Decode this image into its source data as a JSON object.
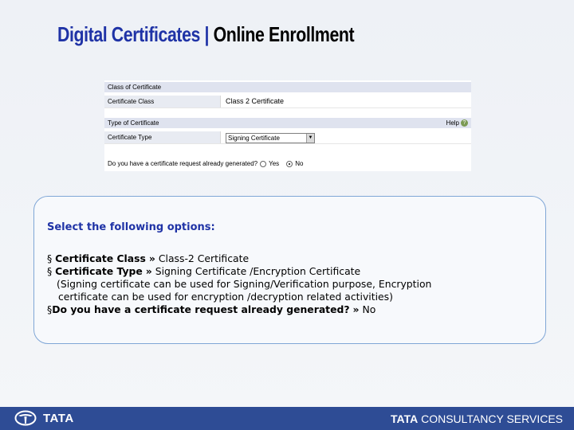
{
  "title": {
    "part1": "Digital Certificates",
    "separator": " | ",
    "part2": "Online Enrollment"
  },
  "form": {
    "section_class": "Class of Certificate",
    "class_label": "Certificate Class",
    "class_value": "Class 2 Certificate",
    "section_type": "Type of Certificate",
    "help_label": "Help",
    "help_icon": "question-icon",
    "type_label": "Certificate Type",
    "type_value": "Signing Certificate",
    "question": "Do you have a certificate request already generated?",
    "option_yes": "Yes",
    "option_no": "No",
    "selected_option": "No"
  },
  "instructions": {
    "heading": "Select the following options:",
    "bullet": "§",
    "item1_label": "Certificate Class",
    "item1_value": "Class-2 Certificate",
    "item2_label": "Certificate Type",
    "item2_value": "Signing Certificate /Encryption Certificate",
    "item2_note1": "(Signing certificate can be used for Signing/Verification purpose, Encryption",
    "item2_note2": "certificate can be used for encryption /decryption related activities)",
    "item3_label": "Do you have a certificate request already generated?",
    "item3_value": "No",
    "arrow": "»"
  },
  "footer": {
    "left_brand": "TATA",
    "right_brand_bold": "TATA",
    "right_brand_rest": "CONSULTANCY SERVICES",
    "bar_color": "#2e4c95"
  }
}
